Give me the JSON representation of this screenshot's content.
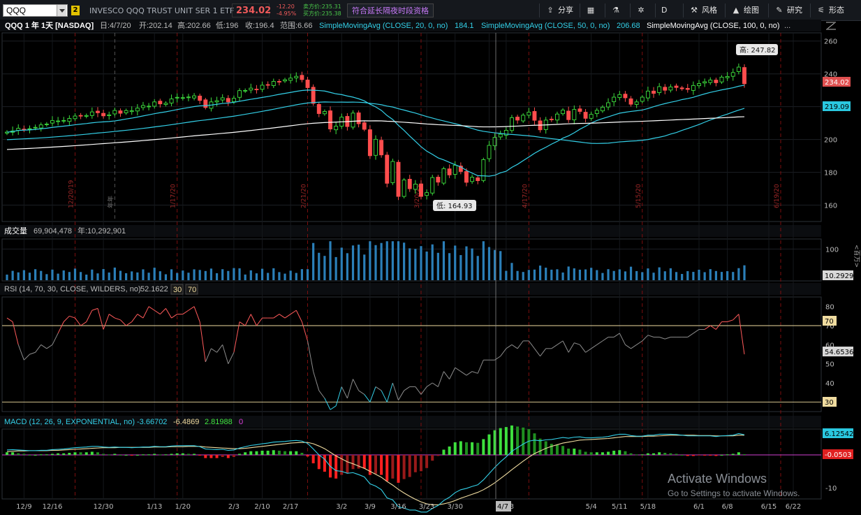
{
  "toolbar": {
    "symbol": "QQQ",
    "link_group": "2",
    "description": "INVESCO QQQ TRUST UNIT SER 1 ETF",
    "last_price": "234.02",
    "net_change": "-12.20",
    "pct_change": "-4.95%",
    "bid": "卖方价:235.31",
    "ask": "买方价:235.38",
    "eth_label": "符合延长隔夜时段资格",
    "buttons": [
      {
        "icon": "share-icon",
        "glyph": "⇪",
        "label": "分享"
      },
      {
        "icon": "calendar-icon",
        "glyph": "▦",
        "label": ""
      },
      {
        "icon": "flask-icon",
        "glyph": "⚗",
        "label": ""
      },
      {
        "icon": "gear-icon",
        "glyph": "✲",
        "label": ""
      },
      {
        "icon": "",
        "glyph": "",
        "label": "D"
      },
      {
        "icon": "style-icon",
        "glyph": "⚒",
        "label": "风格"
      },
      {
        "icon": "cursor-icon",
        "glyph": "▲",
        "label": "绘图"
      },
      {
        "icon": "studies-icon",
        "glyph": "✎",
        "label": "研究"
      },
      {
        "icon": "patterns-icon",
        "glyph": "⚟",
        "label": "形态"
      }
    ]
  },
  "price_panel": {
    "title": "QQQ 1 年 1天 [NASDAQ]",
    "date": "日:4/7/20",
    "open": "开:202.14",
    "high": "高:202.66",
    "low": "低:196",
    "close": "收:196.4",
    "range": "范围:6.66",
    "sma20_label": "SimpleMovingAvg (CLOSE, 20, 0, no)",
    "sma20_value": "184.1",
    "sma50_label": "SimpleMovingAvg (CLOSE, 50, 0, no)",
    "sma50_value": "206.68",
    "sma100_label": "SimpleMovingAvg (CLOSE, 100, 0, no)",
    "more": "...",
    "high_callout": "高: 247.82",
    "low_callout": "低: 164.93",
    "last_tag": "234.02",
    "sma_tag": "219.09",
    "y_ticks": [
      "260",
      "240",
      "220",
      "200",
      "180",
      "160"
    ],
    "event_dates": [
      "12/20/19",
      "1/17/20",
      "2/21/20",
      "3/20/20",
      "4/17/20",
      "5/15/20",
      "6/19/20"
    ],
    "year_marker": "年年"
  },
  "volume_panel": {
    "title": "成交量",
    "value": "69,904,478",
    "annual": "年:10,292,901",
    "y_ticks": [
      "100"
    ],
    "last_tag": "10.2929",
    "unit": "<百万>"
  },
  "rsi_panel": {
    "label": "RSI (14, 70, 30, CLOSE, WILDERS, no)",
    "value": "52.1622",
    "os": "30",
    "ob": "70",
    "y_ticks": [
      "80",
      "70",
      "60",
      "50",
      "40",
      "30"
    ],
    "last_tag": "54.6536",
    "ob_tag": "70",
    "os_tag": "30"
  },
  "macd_panel": {
    "label": "MACD (12, 26, 9, EXPONENTIAL, no)",
    "value": "-3.66702",
    "avg": "-6.4869",
    "diff": "2.81988",
    "zero": "0",
    "y_ticks": [
      "-10"
    ],
    "tag_value": "6.12542",
    "tag_diff": "-0.0503"
  },
  "x_axis": {
    "labels": [
      "12/9",
      "12/16",
      "12/30",
      "1/13",
      "1/20",
      "2/3",
      "2/10",
      "2/17",
      "3/2",
      "3/9",
      "3/16",
      "3/23",
      "3/30",
      "4/7",
      "4/13",
      "5/4",
      "5/11",
      "5/18",
      "6/1",
      "6/8",
      "6/15",
      "6/22"
    ],
    "cursor_label": "4/7"
  },
  "watermark": {
    "title": "Activate Windows",
    "subtitle": "Go to Settings to activate Windows."
  },
  "chart_data": {
    "type": "candlestick",
    "x": [
      "2019-12-04",
      "2019-12-05",
      "2019-12-06",
      "2019-12-09",
      "2019-12-10",
      "2019-12-11",
      "2019-12-12",
      "2019-12-13",
      "2019-12-16",
      "2019-12-17",
      "2019-12-18",
      "2019-12-19",
      "2019-12-20",
      "2019-12-23",
      "2019-12-24",
      "2019-12-26",
      "2019-12-27",
      "2019-12-30",
      "2019-12-31",
      "2020-01-02",
      "2020-01-03",
      "2020-01-06",
      "2020-01-07",
      "2020-01-08",
      "2020-01-09",
      "2020-01-10",
      "2020-01-13",
      "2020-01-14",
      "2020-01-15",
      "2020-01-16",
      "2020-01-17",
      "2020-01-21",
      "2020-01-22",
      "2020-01-23",
      "2020-01-24",
      "2020-01-27",
      "2020-01-28",
      "2020-01-29",
      "2020-01-30",
      "2020-01-31",
      "2020-02-03",
      "2020-02-04",
      "2020-02-05",
      "2020-02-06",
      "2020-02-07",
      "2020-02-10",
      "2020-02-11",
      "2020-02-12",
      "2020-02-13",
      "2020-02-14",
      "2020-02-18",
      "2020-02-19",
      "2020-02-20",
      "2020-02-21",
      "2020-02-24",
      "2020-02-25",
      "2020-02-26",
      "2020-02-27",
      "2020-02-28",
      "2020-03-02",
      "2020-03-03",
      "2020-03-04",
      "2020-03-05",
      "2020-03-06",
      "2020-03-09",
      "2020-03-10",
      "2020-03-11",
      "2020-03-12",
      "2020-03-13",
      "2020-03-16",
      "2020-03-17",
      "2020-03-18",
      "2020-03-19",
      "2020-03-20",
      "2020-03-23",
      "2020-03-24",
      "2020-03-25",
      "2020-03-26",
      "2020-03-27",
      "2020-03-30",
      "2020-03-31",
      "2020-04-01",
      "2020-04-02",
      "2020-04-03",
      "2020-04-06",
      "2020-04-07",
      "2020-04-08",
      "2020-04-09",
      "2020-04-13",
      "2020-04-14",
      "2020-04-15",
      "2020-04-16",
      "2020-04-17",
      "2020-04-20",
      "2020-04-21",
      "2020-04-22",
      "2020-04-23",
      "2020-04-24",
      "2020-04-27",
      "2020-04-28",
      "2020-04-29",
      "2020-04-30",
      "2020-05-01",
      "2020-05-04",
      "2020-05-05",
      "2020-05-06",
      "2020-05-07",
      "2020-05-08",
      "2020-05-11",
      "2020-05-12",
      "2020-05-13",
      "2020-05-14",
      "2020-05-15",
      "2020-05-18",
      "2020-05-19",
      "2020-05-20",
      "2020-05-21",
      "2020-05-22",
      "2020-05-26",
      "2020-05-27",
      "2020-05-28",
      "2020-05-29",
      "2020-06-01",
      "2020-06-02",
      "2020-06-03",
      "2020-06-04",
      "2020-06-05",
      "2020-06-08",
      "2020-06-09",
      "2020-06-10",
      "2020-06-11"
    ],
    "close": [
      204.5,
      205.2,
      206.8,
      206.2,
      206.6,
      207.4,
      208.9,
      209.4,
      211.5,
      211.3,
      211.6,
      212.8,
      214.3,
      214.6,
      214.6,
      216.8,
      216.3,
      214.4,
      215.0,
      217.7,
      216.0,
      217.6,
      217.5,
      219.1,
      220.7,
      220.3,
      222.9,
      221.7,
      222.1,
      224.7,
      225.7,
      225.5,
      225.9,
      226.6,
      223.8,
      219.5,
      222.9,
      223.6,
      225.4,
      222.9,
      225.1,
      229.8,
      229.9,
      231.3,
      230.7,
      233.1,
      233.3,
      235.4,
      235.2,
      236.4,
      237.4,
      238.5,
      236.5,
      231.6,
      222.0,
      215.8,
      217.1,
      206.4,
      208.1,
      213.6,
      207.9,
      216.1,
      209.6,
      206.2,
      190.1,
      200.1,
      190.6,
      173.3,
      186.6,
      165.3,
      175.3,
      170.0,
      172.8,
      165.3,
      167.6,
      176.8,
      174.0,
      182.2,
      178.4,
      184.3,
      180.5,
      173.9,
      177.0,
      174.9,
      187.7,
      196.4,
      201.3,
      203.2,
      205.6,
      213.3,
      211.8,
      214.8,
      216.6,
      211.7,
      205.9,
      211.8,
      212.1,
      215.5,
      217.9,
      212.1,
      218.3,
      217.1,
      212.9,
      215.3,
      217.8,
      219.7,
      222.4,
      225.8,
      227.4,
      225.4,
      221.5,
      222.9,
      225.8,
      229.5,
      228.1,
      232.2,
      230.0,
      232.0,
      231.7,
      230.9,
      230.5,
      232.9,
      234.1,
      235.2,
      236.2,
      234.6,
      238.0,
      238.4,
      240.8,
      244.1,
      234.0
    ],
    "series": [
      {
        "name": "SimpleMovingAvg (CLOSE, 20, 0, no)",
        "last": 184.1
      },
      {
        "name": "SimpleMovingAvg (CLOSE, 50, 0, no)",
        "last": 206.68
      },
      {
        "name": "SimpleMovingAvg (CLOSE, 100, 0, no)"
      }
    ],
    "ylim": [
      150,
      265
    ],
    "annotations": {
      "high": 247.82,
      "low": 164.93,
      "last": 234.02,
      "sma_tag": 219.09
    },
    "rsi": [
      74,
      72,
      60,
      52,
      55,
      56,
      60,
      58,
      60,
      66,
      72,
      75,
      74,
      70,
      72,
      78,
      79,
      68,
      76,
      74,
      73,
      70,
      72,
      76,
      74,
      80,
      78,
      76,
      79,
      74,
      76,
      76,
      78,
      80,
      72,
      51,
      58,
      56,
      60,
      50,
      56,
      72,
      70,
      76,
      70,
      74,
      74,
      74,
      76,
      74,
      76,
      78,
      72,
      62,
      46,
      36,
      32,
      26,
      28,
      38,
      32,
      42,
      36,
      34,
      30,
      38,
      36,
      30,
      40,
      31,
      36,
      38,
      38,
      34,
      38,
      40,
      38,
      46,
      42,
      48,
      46,
      44,
      46,
      45,
      52,
      52,
      52,
      54,
      58,
      60,
      58,
      62,
      62,
      58,
      54,
      58,
      58,
      60,
      62,
      56,
      61,
      60,
      56,
      58,
      60,
      62,
      64,
      64,
      66,
      60,
      58,
      60,
      62,
      65,
      64,
      64,
      63,
      64,
      64,
      64,
      64,
      66,
      68,
      68,
      70,
      68,
      72,
      72,
      73,
      76,
      55
    ],
    "macd_value": [
      1.5,
      1.6,
      1.5,
      1.4,
      1.3,
      1.3,
      1.4,
      1.4,
      1.6,
      1.7,
      1.8,
      2.0,
      2.2,
      2.3,
      2.4,
      2.6,
      2.6,
      2.4,
      2.3,
      2.4,
      2.3,
      2.3,
      2.2,
      2.3,
      2.4,
      2.4,
      2.6,
      2.5,
      2.5,
      2.7,
      2.8,
      2.8,
      2.8,
      2.8,
      2.5,
      1.8,
      1.7,
      1.6,
      1.7,
      1.4,
      1.5,
      2.1,
      2.5,
      2.9,
      3.1,
      3.4,
      3.6,
      3.9,
      4.0,
      4.1,
      4.3,
      4.4,
      4.2,
      3.5,
      1.8,
      0.0,
      -1.3,
      -3.5,
      -4.8,
      -5.0,
      -5.6,
      -5.4,
      -6.0,
      -6.7,
      -8.8,
      -9.5,
      -10.6,
      -13.1,
      -13.7,
      -15.8,
      -16.2,
      -16.8,
      -16.8,
      -17.4,
      -17.4,
      -16.3,
      -15.4,
      -13.9,
      -12.9,
      -11.5,
      -10.6,
      -10.2,
      -9.6,
      -9.1,
      -7.6,
      -5.7,
      -3.8,
      -2.1,
      -0.6,
      1.1,
      2.2,
      3.3,
      4.2,
      4.5,
      4.3,
      4.6,
      4.7,
      5.0,
      5.3,
      5.1,
      5.4,
      5.5,
      5.2,
      5.2,
      5.3,
      5.4,
      5.6,
      6.0,
      6.3,
      6.3,
      5.9,
      5.7,
      5.7,
      6.0,
      6.0,
      6.3,
      6.3,
      6.3,
      6.2,
      6.0,
      5.8,
      5.8,
      5.8,
      5.8,
      5.8,
      5.6,
      5.8,
      5.9,
      6.0,
      6.5,
      6.13
    ],
    "macd_avg": [
      1.0,
      1.1,
      1.2,
      1.2,
      1.3,
      1.3,
      1.3,
      1.3,
      1.4,
      1.4,
      1.5,
      1.6,
      1.7,
      1.8,
      1.9,
      2.0,
      2.1,
      2.2,
      2.2,
      2.2,
      2.3,
      2.3,
      2.3,
      2.3,
      2.3,
      2.3,
      2.4,
      2.4,
      2.4,
      2.5,
      2.5,
      2.5,
      2.6,
      2.6,
      2.6,
      2.4,
      2.3,
      2.2,
      2.1,
      2.0,
      1.9,
      1.9,
      2.0,
      2.2,
      2.4,
      2.6,
      2.8,
      3.0,
      3.2,
      3.4,
      3.6,
      3.7,
      3.8,
      3.8,
      3.4,
      2.7,
      1.9,
      0.8,
      -0.3,
      -1.2,
      -2.1,
      -2.7,
      -3.4,
      -4.1,
      -5.0,
      -5.9,
      -6.8,
      -8.1,
      -9.2,
      -10.5,
      -11.6,
      -12.6,
      -13.5,
      -14.3,
      -14.9,
      -15.2,
      -15.2,
      -14.9,
      -14.5,
      -13.9,
      -13.2,
      -12.6,
      -12.0,
      -11.4,
      -10.6,
      -9.6,
      -8.5,
      -7.2,
      -5.9,
      -4.5,
      -3.2,
      -1.9,
      -0.7,
      0.4,
      1.2,
      2.0,
      2.6,
      3.1,
      3.6,
      3.9,
      4.2,
      4.5,
      4.6,
      4.7,
      4.8,
      4.9,
      5.0,
      5.2,
      5.4,
      5.6,
      5.6,
      5.6,
      5.6,
      5.7,
      5.7,
      5.8,
      5.9,
      6.0,
      6.0,
      6.0,
      6.0,
      6.0,
      5.9,
      5.9,
      5.9,
      5.8,
      5.8,
      5.8,
      5.8,
      6.0,
      6.0
    ]
  }
}
